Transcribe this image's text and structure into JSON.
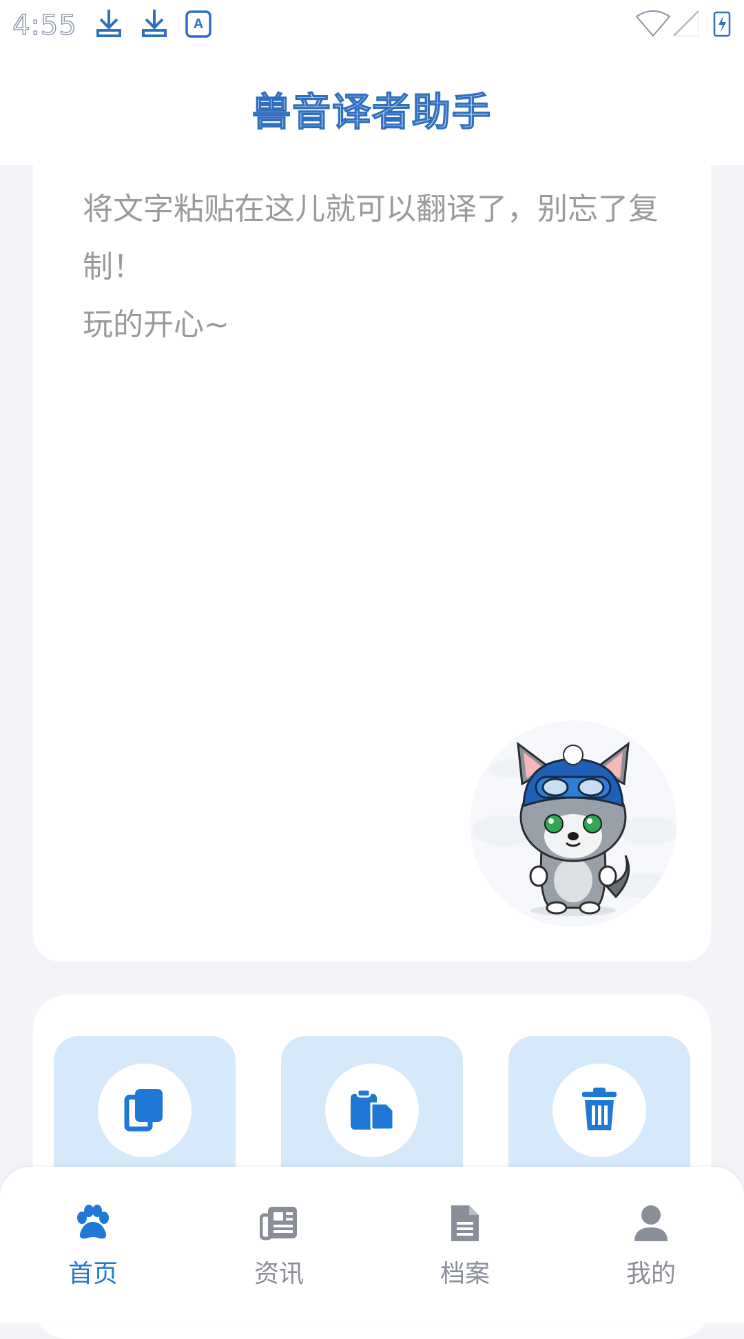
{
  "status_bar": {
    "time": "4:55",
    "icons": [
      "download-icon",
      "download-icon",
      "text-a-icon",
      "wifi-icon",
      "signal-icon",
      "battery-charging-icon"
    ]
  },
  "header": {
    "title": "兽音译者助手"
  },
  "input_card": {
    "placeholder_lines": "将文字粘贴在这儿就可以翻译了，别忘了复制！\n玩的开心~",
    "mascot": "husky-pilot-mascot"
  },
  "actions": [
    {
      "icon": "copy-icon"
    },
    {
      "icon": "paste-icon"
    },
    {
      "icon": "trash-icon"
    }
  ],
  "bottom_nav": {
    "active_index": 0,
    "items": [
      {
        "label": "首页",
        "icon": "paw-icon"
      },
      {
        "label": "资讯",
        "icon": "newspaper-icon"
      },
      {
        "label": "档案",
        "icon": "document-icon"
      },
      {
        "label": "我的",
        "icon": "person-icon"
      }
    ]
  },
  "colors": {
    "accent": "#1f77d6",
    "action_bg": "#d5e9fa",
    "page_bg": "#f2f4f8",
    "inactive": "#8a8e99"
  }
}
